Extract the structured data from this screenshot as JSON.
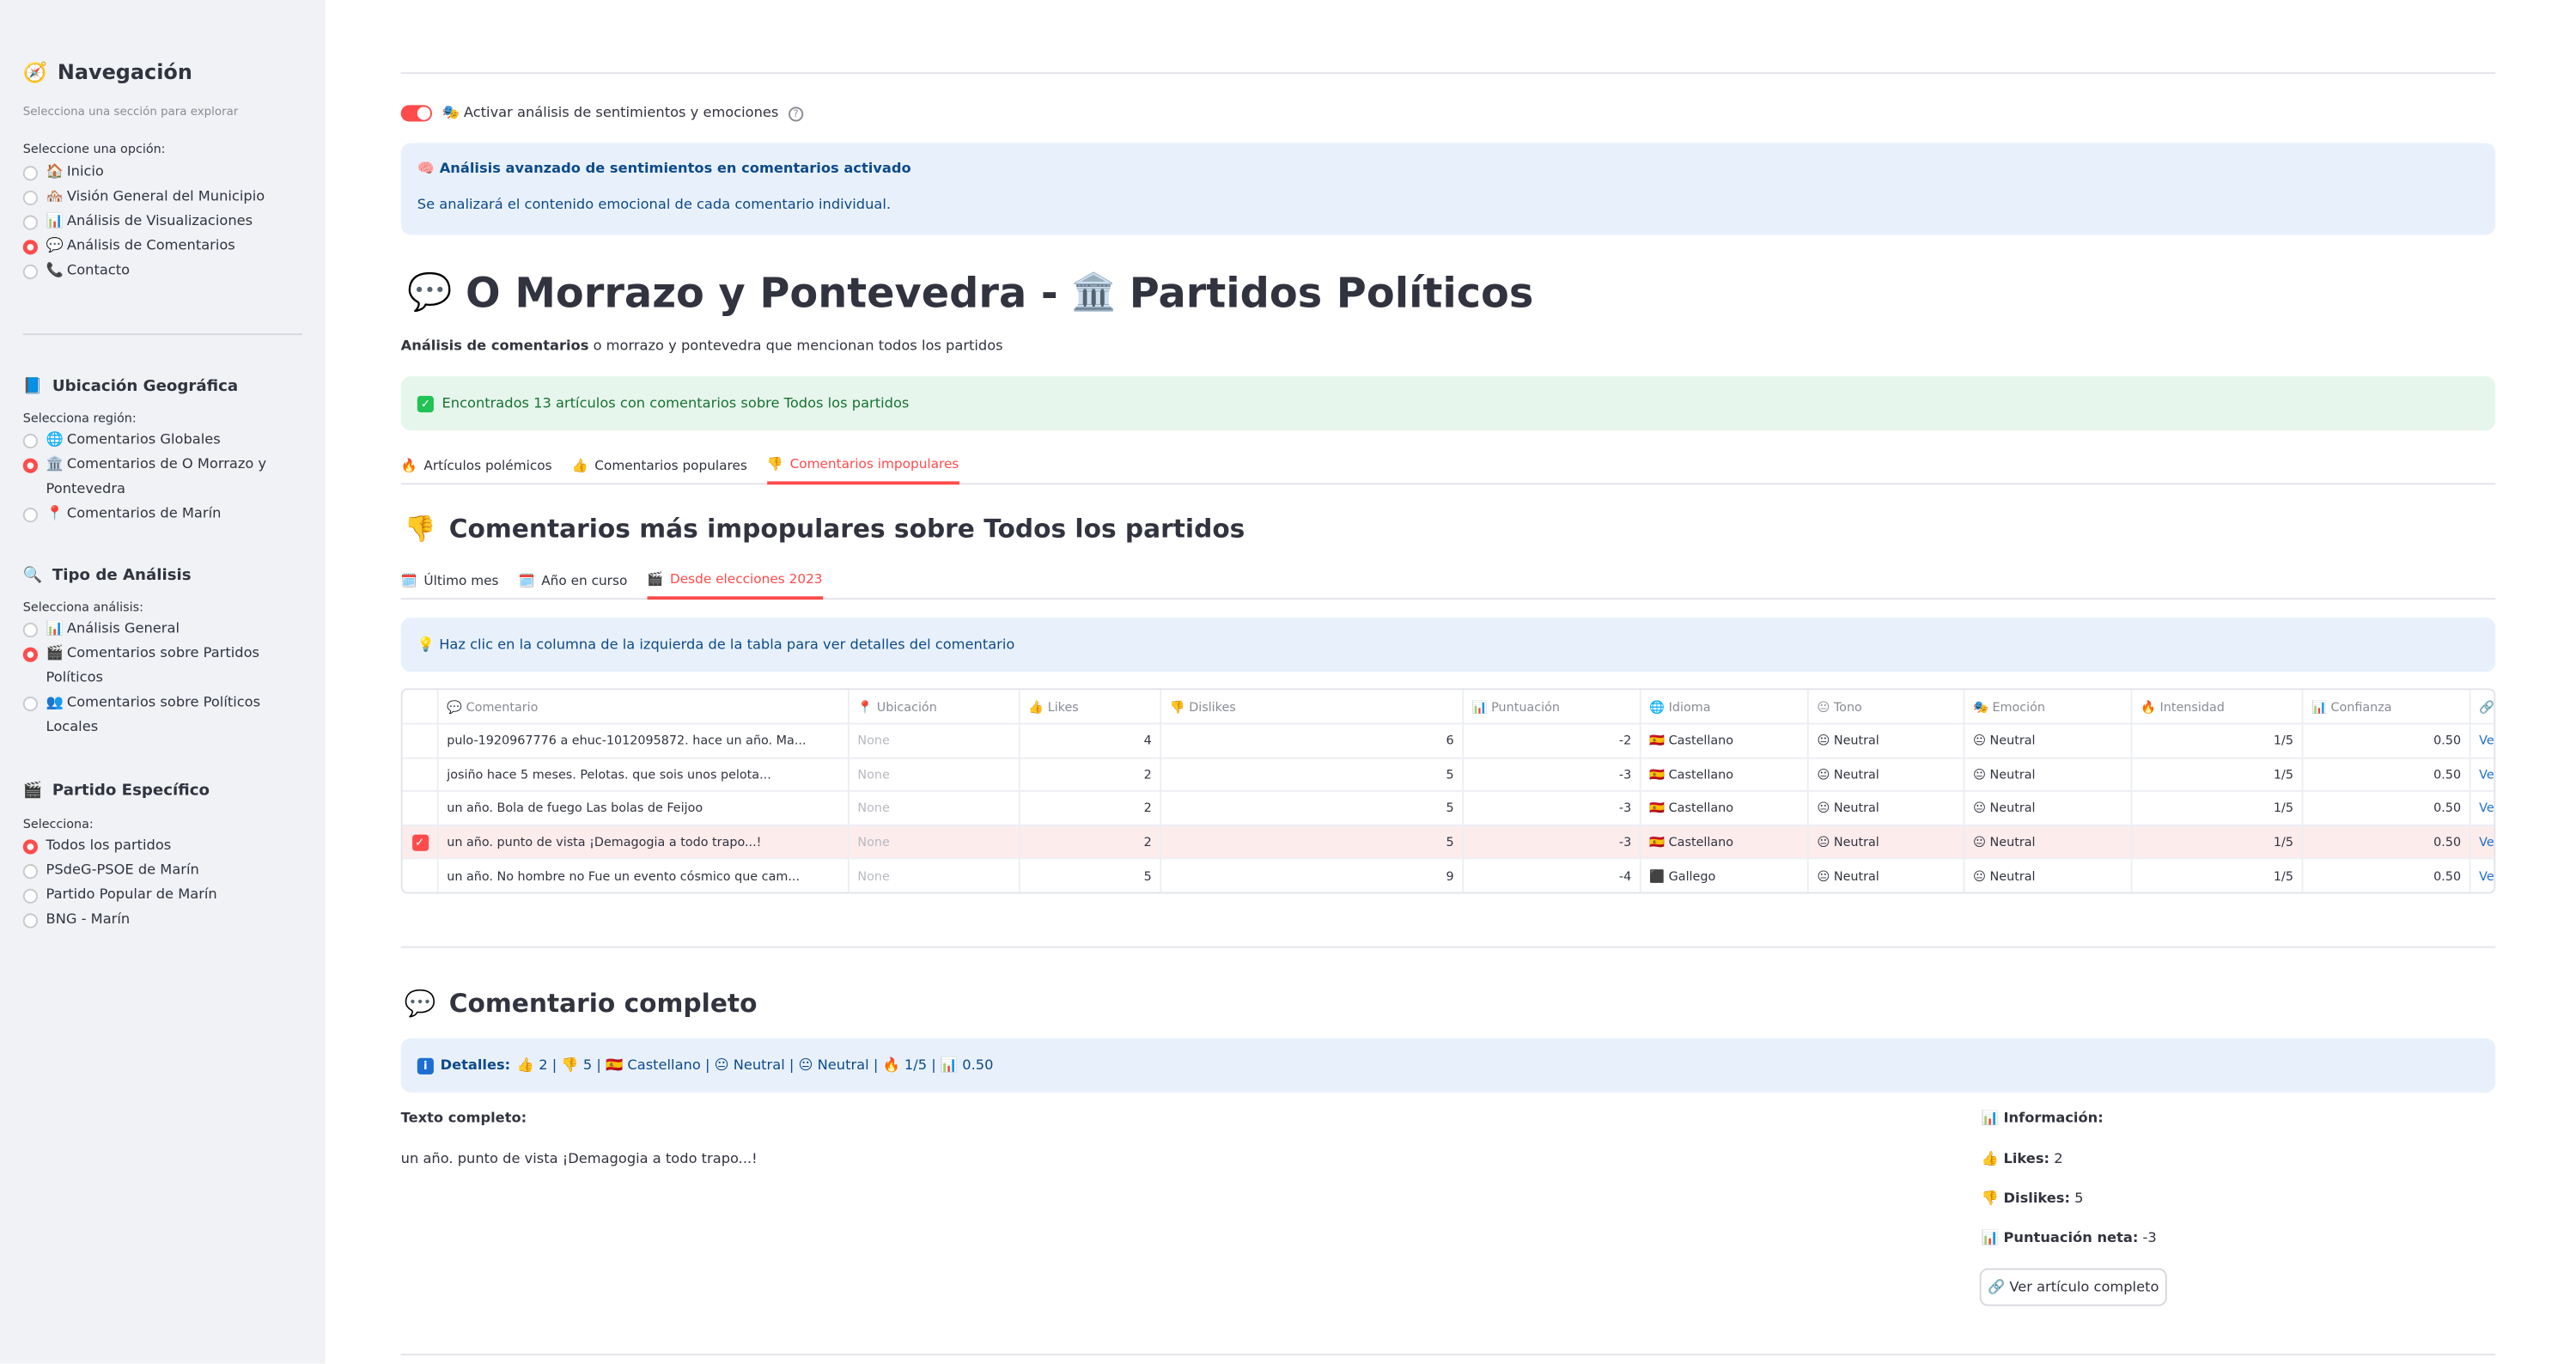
{
  "sidebar": {
    "title": "Navegación",
    "caption": "Selecciona una sección para explorar",
    "nav_label": "Seleccione una opción:",
    "nav_options": [
      {
        "icon": "🏠",
        "label": "Inicio",
        "selected": false
      },
      {
        "icon": "🏘️",
        "label": "Visión General del Municipio",
        "selected": false
      },
      {
        "icon": "📊",
        "label": "Análisis de Visualizaciones",
        "selected": false
      },
      {
        "icon": "💬",
        "label": "Análisis de Comentarios",
        "selected": true
      },
      {
        "icon": "📞",
        "label": "Contacto",
        "selected": false
      }
    ],
    "geo": {
      "title": "Ubicación Geográfica",
      "label": "Selecciona región:",
      "options": [
        {
          "icon": "🌐",
          "label": "Comentarios Globales",
          "selected": false
        },
        {
          "icon": "🏛️",
          "label": "Comentarios de O Morrazo y Pontevedra",
          "selected": true
        },
        {
          "icon": "📍",
          "label": "Comentarios de Marín",
          "selected": false
        }
      ]
    },
    "analysis": {
      "title": "Tipo de Análisis",
      "label": "Selecciona análisis:",
      "options": [
        {
          "icon": "📊",
          "label": "Análisis General",
          "selected": false
        },
        {
          "icon": "🎬",
          "label": "Comentarios sobre Partidos Políticos",
          "selected": true
        },
        {
          "icon": "👥",
          "label": "Comentarios sobre Políticos Locales",
          "selected": false
        }
      ]
    },
    "party": {
      "title": "Partido Específico",
      "label": "Selecciona:",
      "options": [
        {
          "label": "Todos los partidos",
          "selected": true
        },
        {
          "label": "PSdeG-PSOE de Marín",
          "selected": false
        },
        {
          "label": "Partido Popular de Marín",
          "selected": false
        },
        {
          "label": "BNG - Marín",
          "selected": false
        }
      ]
    }
  },
  "toggle": {
    "label": "🎭 Activar análisis de sentimientos y emociones",
    "on": true
  },
  "info_box": {
    "title": "🧠 Análisis avanzado de sentimientos en comentarios activado",
    "body": "Se analizará el contenido emocional de cada comentario individual."
  },
  "page_title": {
    "part1": "O Morrazo y Pontevedra -",
    "part2": "Partidos Políticos"
  },
  "subtitle": {
    "bold": "Análisis de comentarios",
    "rest": " o morrazo y pontevedra que mencionan todos los partidos"
  },
  "success_box": "Encontrados 13 artículos con comentarios sobre Todos los partidos",
  "tabs": [
    {
      "icon": "🔥",
      "label": "Artículos polémicos",
      "active": false
    },
    {
      "icon": "👍",
      "label": "Comentarios populares",
      "active": false
    },
    {
      "icon": "👎",
      "label": "Comentarios impopulares",
      "active": true
    }
  ],
  "section_title": "Comentarios más impopulares sobre Todos los partidos",
  "period_tabs": [
    {
      "icon": "🗓️",
      "label": "Último mes",
      "active": false
    },
    {
      "icon": "🗓️",
      "label": "Año en curso",
      "active": false
    },
    {
      "icon": "🎬",
      "label": "Desde elecciones 2023",
      "active": true
    }
  ],
  "hint": "💡 Haz clic en la columna de la izquierda de la tabla para ver detalles del comentario",
  "table": {
    "headers": [
      "💬 Comentario",
      "📍 Ubicación",
      "👍 Likes",
      "👎 Dislikes",
      "📊 Puntuación",
      "🌐 Idioma",
      "😐 Tono",
      "🎭 Emoción",
      "🔥 Intensidad",
      "📊 Confianza",
      "🔗 Artículo"
    ],
    "rows": [
      {
        "selected": false,
        "cells": [
          "pulo-1920967776 a ehuc-1012095872. hace un año. Ma...",
          "None",
          "4",
          "6",
          "-2",
          "🇪🇸 Castellano",
          "😐 Neutral",
          "😐 Neutral",
          "1/5",
          "0.50",
          "Ver"
        ]
      },
      {
        "selected": false,
        "cells": [
          "josiño hace 5 meses. Pelotas. que sois unos pelota...",
          "None",
          "2",
          "5",
          "-3",
          "🇪🇸 Castellano",
          "😐 Neutral",
          "😐 Neutral",
          "1/5",
          "0.50",
          "Ver"
        ]
      },
      {
        "selected": false,
        "cells": [
          "un año. Bola de fuego Las bolas de Feijoo",
          "None",
          "2",
          "5",
          "-3",
          "🇪🇸 Castellano",
          "😐 Neutral",
          "😐 Neutral",
          "1/5",
          "0.50",
          "Ver"
        ]
      },
      {
        "selected": true,
        "cells": [
          "un año. punto de vista ¡Demagogia a todo trapo...!",
          "None",
          "2",
          "5",
          "-3",
          "🇪🇸 Castellano",
          "😐 Neutral",
          "😐 Neutral",
          "1/5",
          "0.50",
          "Ver"
        ]
      },
      {
        "selected": false,
        "cells": [
          "un año. No hombre no Fue un evento cósmico que cam...",
          "None",
          "5",
          "9",
          "-4",
          "⬛ Gallego",
          "😐 Neutral",
          "😐 Neutral",
          "1/5",
          "0.50",
          "Ver"
        ]
      }
    ]
  },
  "full_comment": {
    "title": "Comentario completo",
    "details_label": "Detalles:",
    "details_value": "👍 2 | 👎 5 | 🇪🇸 Castellano | 😐 Neutral | 😐 Neutral | 🔥 1/5 | 📊 0.50",
    "text_label": "Texto completo:",
    "text": "un año. punto de vista ¡Demagogia a todo trapo...!",
    "info_label": "📊 Información:",
    "likes_label": "👍 Likes:",
    "likes_value": "2",
    "dislikes_label": "👎 Dislikes:",
    "dislikes_value": "5",
    "score_label": "📊 Puntuación neta:",
    "score_value": "-3",
    "button": "🔗 Ver artículo completo"
  },
  "colors": {
    "accent": "#ff4b4b",
    "info_bg": "#e8f1fb",
    "success_bg": "#e7f6ec",
    "link": "#1c6fd1"
  }
}
